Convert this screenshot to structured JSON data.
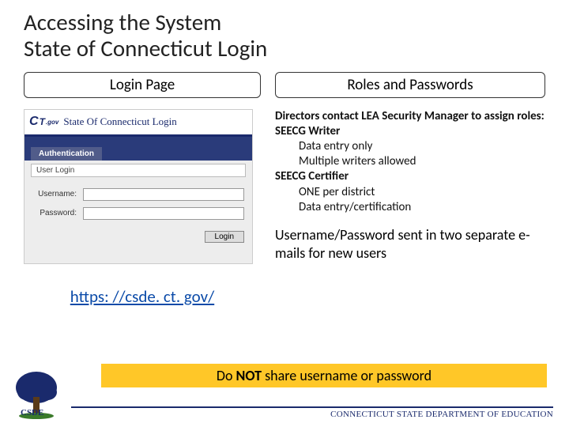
{
  "title_line1": "Accessing the System",
  "title_line2": "State of Connecticut Login",
  "left": {
    "subhead": "Login Page",
    "ctgov": "CT.gov",
    "banner": "State Of Connecticut Login",
    "auth_tab": "Authentication",
    "user_login": "User Login",
    "username_label": "Username:",
    "password_label": "Password:",
    "login_btn": "Login",
    "url": "https: //csde. ct. gov/"
  },
  "right": {
    "subhead": "Roles and Passwords",
    "intro": "Directors contact LEA Security Manager to assign roles:",
    "role1": "SEECG Writer",
    "role1a": "Data entry only",
    "role1b": "Multiple writers allowed",
    "role2": "SEECG Certifier",
    "role2a": "ONE per district",
    "role2b": "Data entry/certification",
    "note_bold": "Username/Password",
    "note_rest": " sent in two separate e-mails for new users"
  },
  "warn": {
    "pre": "Do ",
    "not": "NOT",
    "post": " share username or password"
  },
  "dept": "CONNECTICUT STATE DEPARTMENT OF EDUCATION",
  "csde": "CSDE"
}
